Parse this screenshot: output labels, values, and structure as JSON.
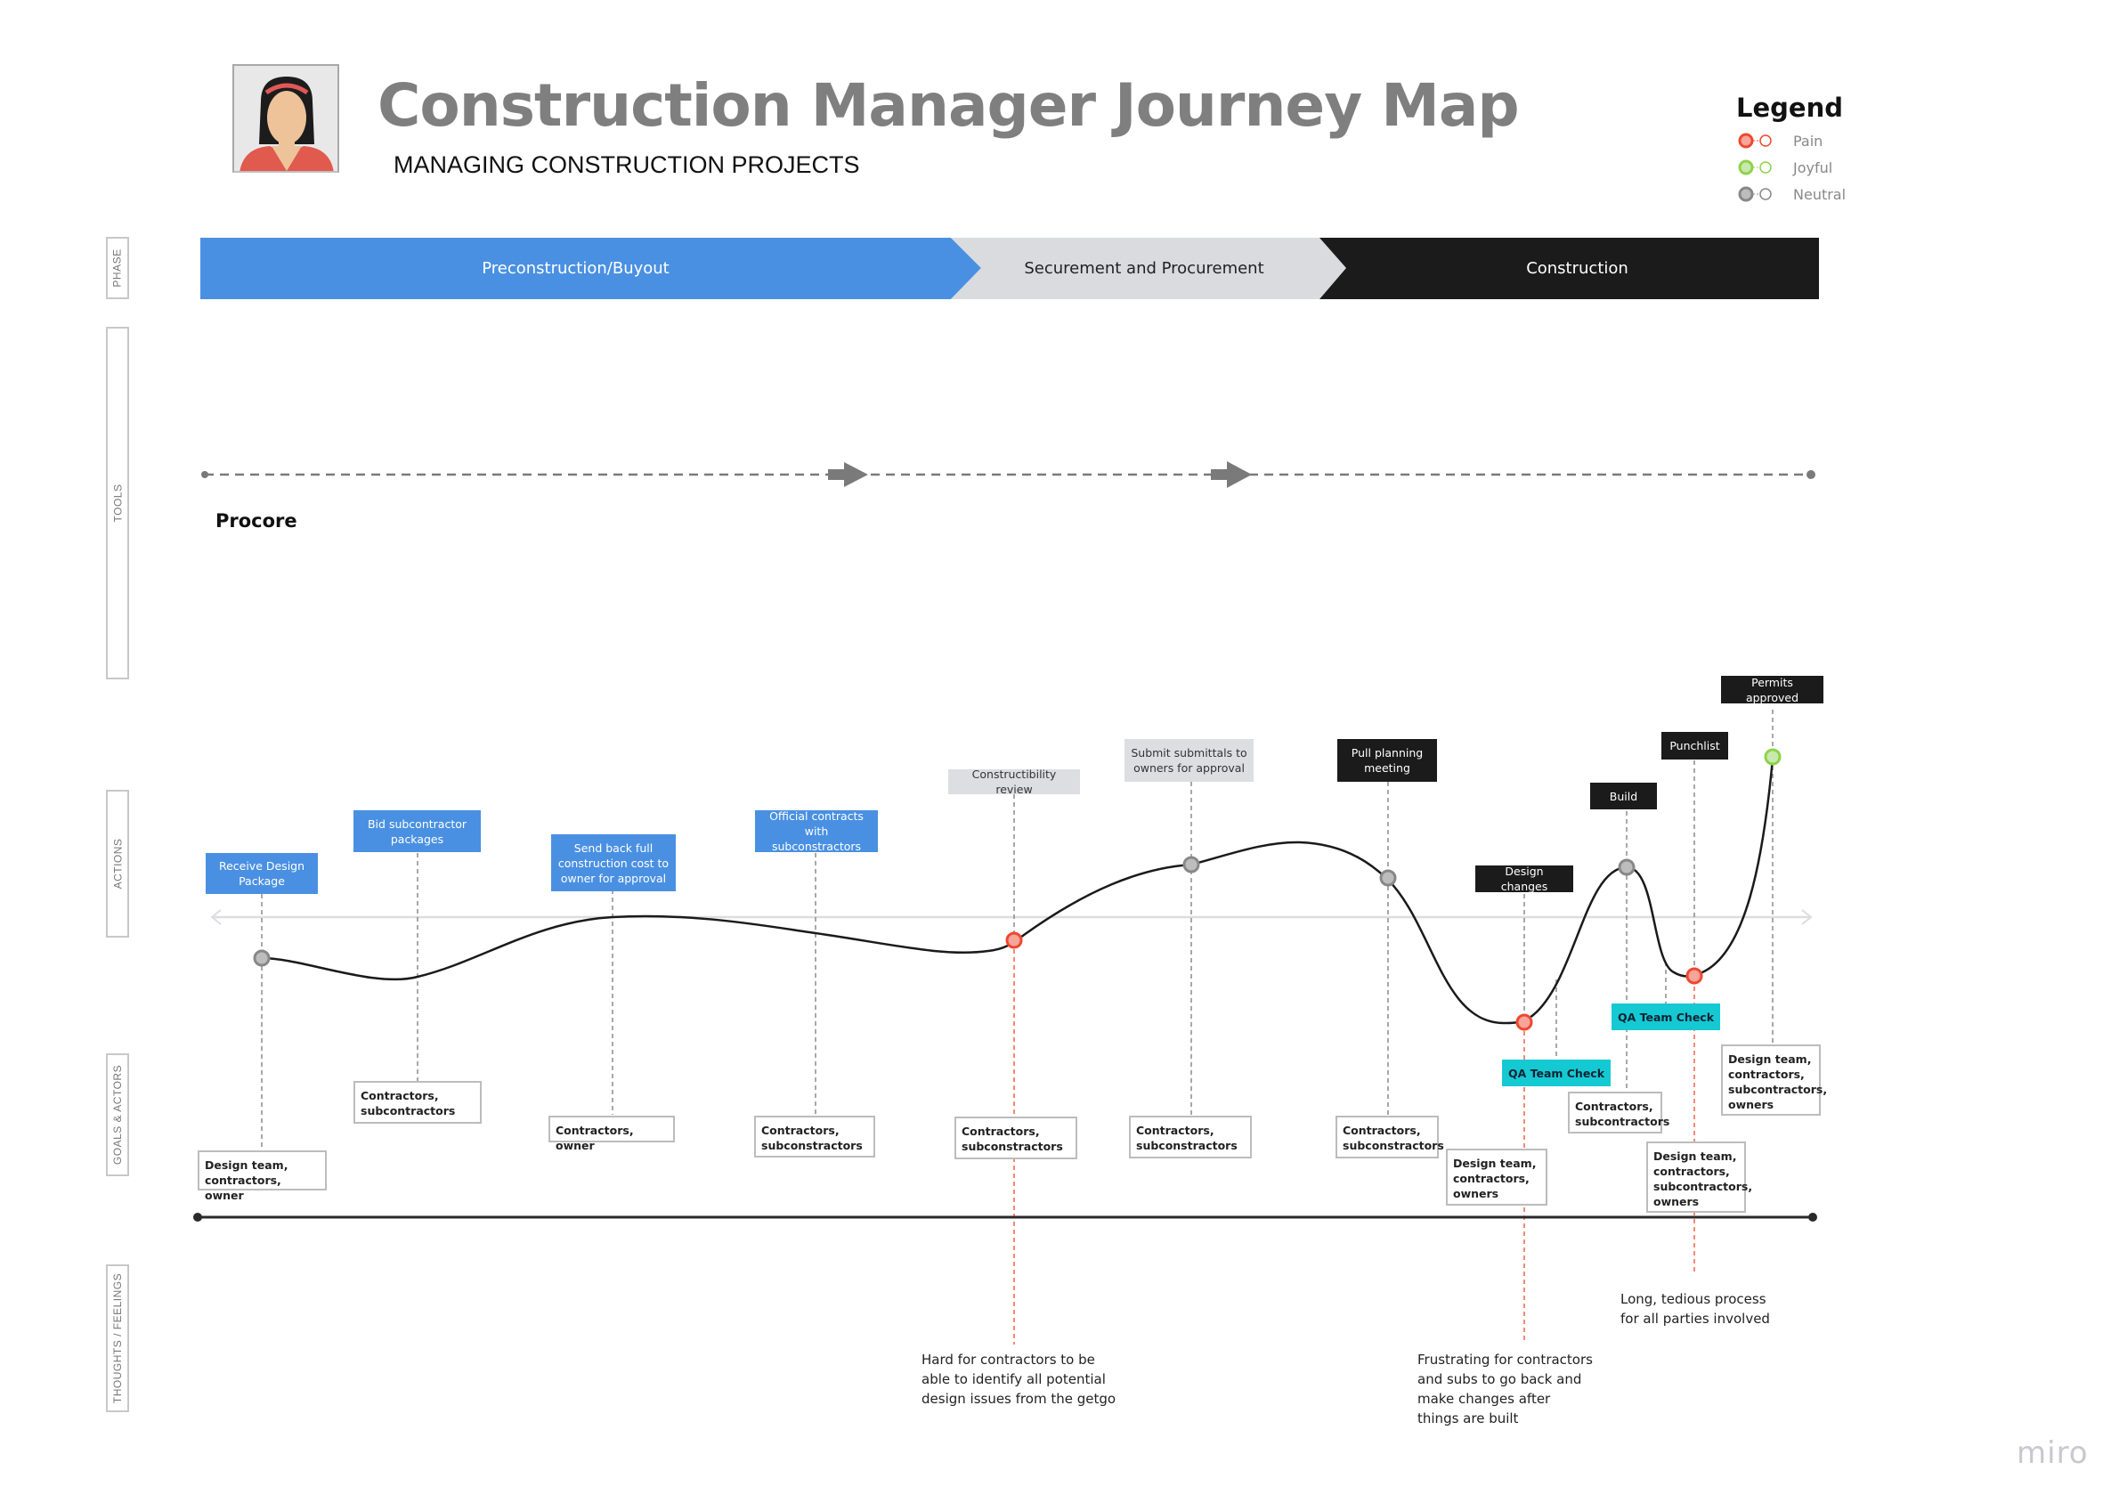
{
  "header": {
    "title": "Construction Manager Journey Map",
    "subtitle": "MANAGING CONSTRUCTION PROJECTS",
    "avatar_icon": "persona-avatar-woman"
  },
  "legend": {
    "title": "Legend",
    "items": [
      {
        "label": "Pain",
        "color": "#f0472f",
        "fill": "#f5a59a"
      },
      {
        "label": "Joyful",
        "color": "#8ed24b",
        "fill": "#c9e8ad"
      },
      {
        "label": "Neutral",
        "color": "#888888",
        "fill": "#bdbdbd"
      }
    ]
  },
  "lanes": {
    "phase": "PHASE",
    "tools": "TOOLS",
    "actions": "ACTIONS",
    "goals": "GOALS & ACTORS",
    "thoughts": "THOUGHTS / FEELINGS"
  },
  "phases": [
    {
      "label": "Preconstruction/Buyout",
      "color": "#4a90e2",
      "text_color": "#ffffff"
    },
    {
      "label": "Securement and Procurement",
      "color": "#d9dbdf",
      "text_color": "#222222"
    },
    {
      "label": "Construction",
      "color": "#1b1b1b",
      "text_color": "#ffffff"
    }
  ],
  "tools": {
    "items": [
      "Procore"
    ]
  },
  "actions": [
    {
      "label": "Receive Design Package",
      "style": "blue",
      "emotion": "neutral"
    },
    {
      "label": "Bid subcontractor packages",
      "style": "blue",
      "emotion": "none"
    },
    {
      "label": "Send back full construction cost to owner for approval",
      "style": "blue",
      "emotion": "none"
    },
    {
      "label": "Official contracts with subconstractors",
      "style": "blue",
      "emotion": "none"
    },
    {
      "label": "Constructibility review",
      "style": "gray",
      "emotion": "pain"
    },
    {
      "label": "Submit submittals to owners for approval",
      "style": "gray",
      "emotion": "neutral"
    },
    {
      "label": "Pull planning meeting",
      "style": "black",
      "emotion": "neutral"
    },
    {
      "label": "Design changes",
      "style": "black",
      "emotion": "pain"
    },
    {
      "label": "QA Team Check",
      "style": "teal",
      "emotion": "none"
    },
    {
      "label": "Build",
      "style": "black",
      "emotion": "neutral"
    },
    {
      "label": "QA Team Check",
      "style": "teal",
      "emotion": "none"
    },
    {
      "label": "Punchlist",
      "style": "black",
      "emotion": "pain"
    },
    {
      "label": "Permits approved",
      "style": "black",
      "emotion": "joyful"
    }
  ],
  "goals": [
    "Design team, contractors, owner",
    "Contractors, subcontractors",
    "Contractors, owner",
    "Contractors, subconstractors",
    "Contractors, subconstractors",
    "Contractors, subconstractors",
    "Contractors, subconstractors",
    "Design team, contractors, owners",
    "Contractors, subcontractors",
    "Design team, contractors, subcontractors, owners",
    "Design team, contractors, subcontractors, owners"
  ],
  "thoughts": [
    "Hard for contractors to be able to identify all potential design issues from the getgo",
    "Frustrating for contractors and subs to go back and make changes after things are built",
    "Long, tedious process for all parties involved"
  ],
  "branding": {
    "logo": "miro"
  }
}
